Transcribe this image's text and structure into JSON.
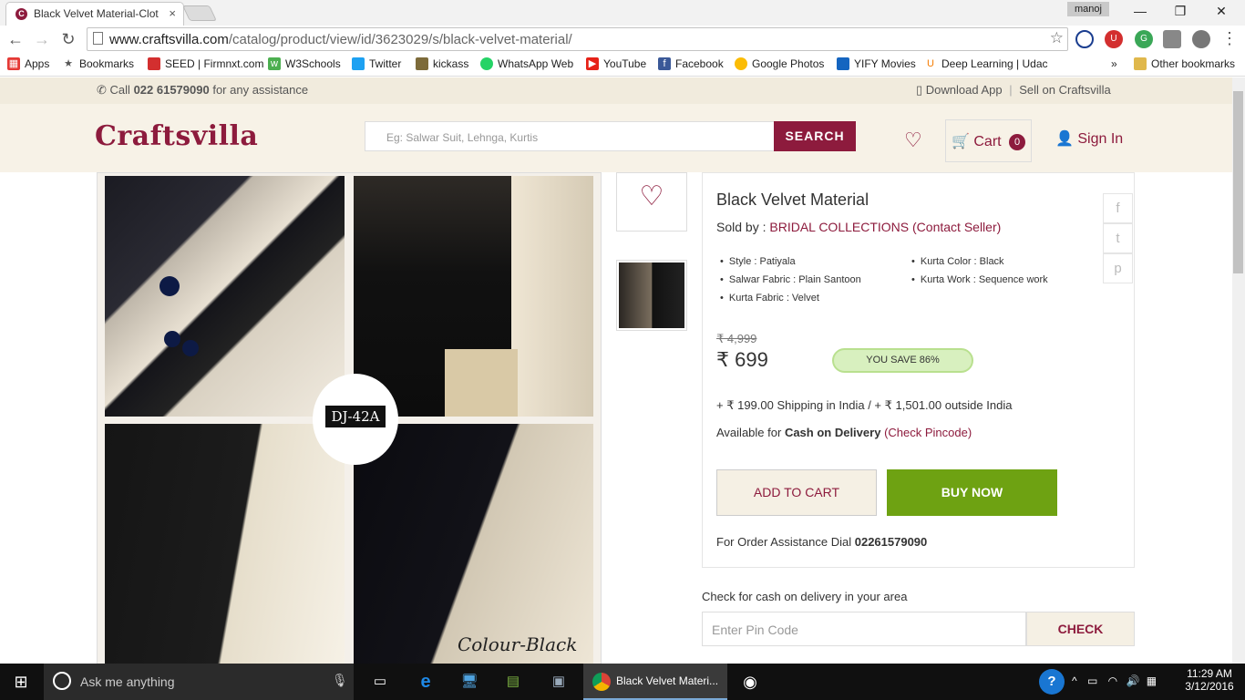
{
  "browser": {
    "tab_title": "Black Velvet Material-Clot",
    "user": "manoj",
    "url_host": "www.craftsvilla.com",
    "url_path": "/catalog/product/view/id/3623029/s/black-velvet-material/",
    "bookmarks": [
      "Apps",
      "Bookmarks",
      "SEED | Firmnxt.com",
      "W3Schools",
      "Twitter",
      "kickass",
      "WhatsApp Web",
      "YouTube",
      "Facebook",
      "Google Photos",
      "YIFY Movies",
      "Deep Learning | Udac"
    ],
    "other_bookmarks": "Other bookmarks",
    "overflow": "»"
  },
  "site": {
    "call_prefix": "Call",
    "call_number": "022 61579090",
    "call_suffix": "for any assistance",
    "download_app": "Download App",
    "sell": "Sell on Craftsvilla",
    "logo": "Craftsvilla",
    "search_placeholder": "Eg: Salwar Suit, Lehnga, Kurtis",
    "search_button": "SEARCH",
    "cart_label": "Cart",
    "cart_count": "0",
    "signin": "Sign In"
  },
  "product": {
    "image_badge": "DJ-42A",
    "image_caption": "Colour-Black",
    "title": "Black Velvet Material",
    "sold_by_label": "Sold by :",
    "seller": "BRIDAL COLLECTIONS",
    "contact_seller": "(Contact Seller)",
    "specs_left": [
      "Style : Patiyala",
      "Salwar Fabric : Plain Santoon",
      "Kurta Fabric : Velvet"
    ],
    "specs_right": [
      "Kurta Color : Black",
      "Kurta Work : Sequence work"
    ],
    "mrp": "₹ 4,999",
    "price": "₹ 699",
    "you_save": "YOU SAVE 86%",
    "shipping": "+ ₹ 199.00 Shipping in India / + ₹ 1,501.00 outside India",
    "cod_prefix": "Available for",
    "cod_bold": "Cash on Delivery",
    "check_pincode": "(Check Pincode)",
    "add_to_cart": "ADD TO CART",
    "buy_now": "BUY NOW",
    "assist_prefix": "For Order Assistance Dial",
    "assist_number": "02261579090",
    "cod_check_title": "Check for cash on delivery in your area",
    "pin_placeholder": "Enter Pin Code",
    "check_button": "CHECK"
  },
  "taskbar": {
    "search_placeholder": "Ask me anything",
    "active_window": "Black Velvet Materi...",
    "time": "11:29 AM",
    "date": "3/12/2016"
  }
}
